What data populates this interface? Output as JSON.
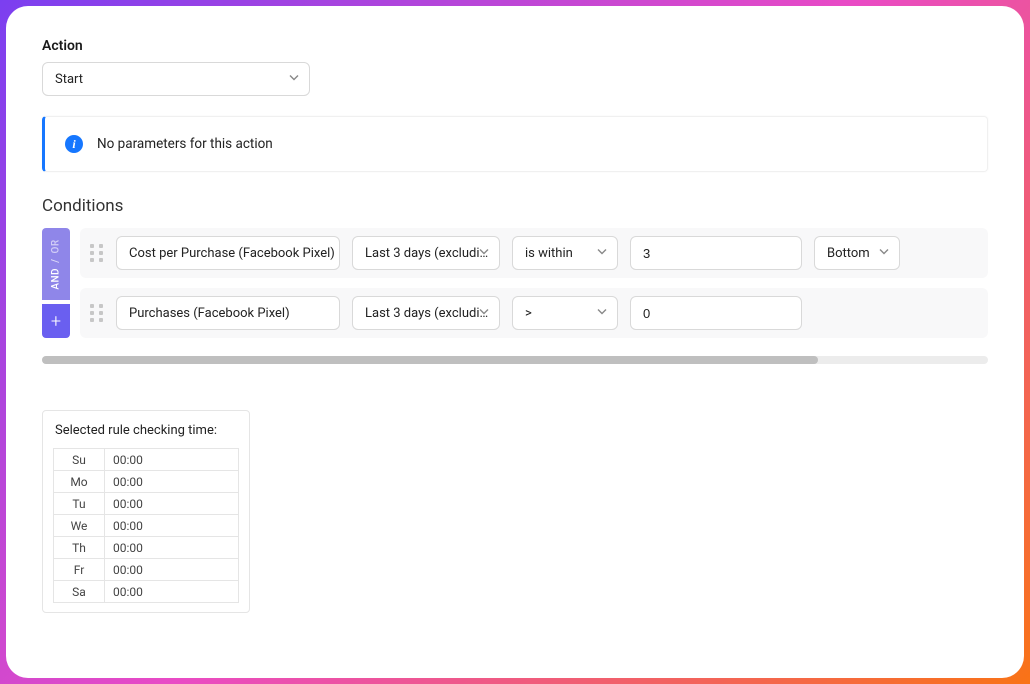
{
  "action": {
    "label": "Action",
    "selected": "Start"
  },
  "info_banner": {
    "message": "No parameters for this action"
  },
  "conditions": {
    "title": "Conditions",
    "logic": {
      "and": "AND",
      "or": "OR",
      "plus": "+"
    },
    "rows": [
      {
        "metric": "Cost per Purchase (Facebook Pixel)",
        "timeframe": "Last 3 days (excludi…",
        "operator": "is within",
        "value": "3",
        "rank": "Bottom"
      },
      {
        "metric": "Purchases (Facebook Pixel)",
        "timeframe": "Last 3 days (excludi…",
        "operator": ">",
        "value": "0",
        "rank": ""
      }
    ]
  },
  "schedule": {
    "title": "Selected rule checking time:",
    "rows": [
      {
        "day": "Su",
        "time": "00:00"
      },
      {
        "day": "Mo",
        "time": "00:00"
      },
      {
        "day": "Tu",
        "time": "00:00"
      },
      {
        "day": "We",
        "time": "00:00"
      },
      {
        "day": "Th",
        "time": "00:00"
      },
      {
        "day": "Fr",
        "time": "00:00"
      },
      {
        "day": "Sa",
        "time": "00:00"
      }
    ]
  }
}
